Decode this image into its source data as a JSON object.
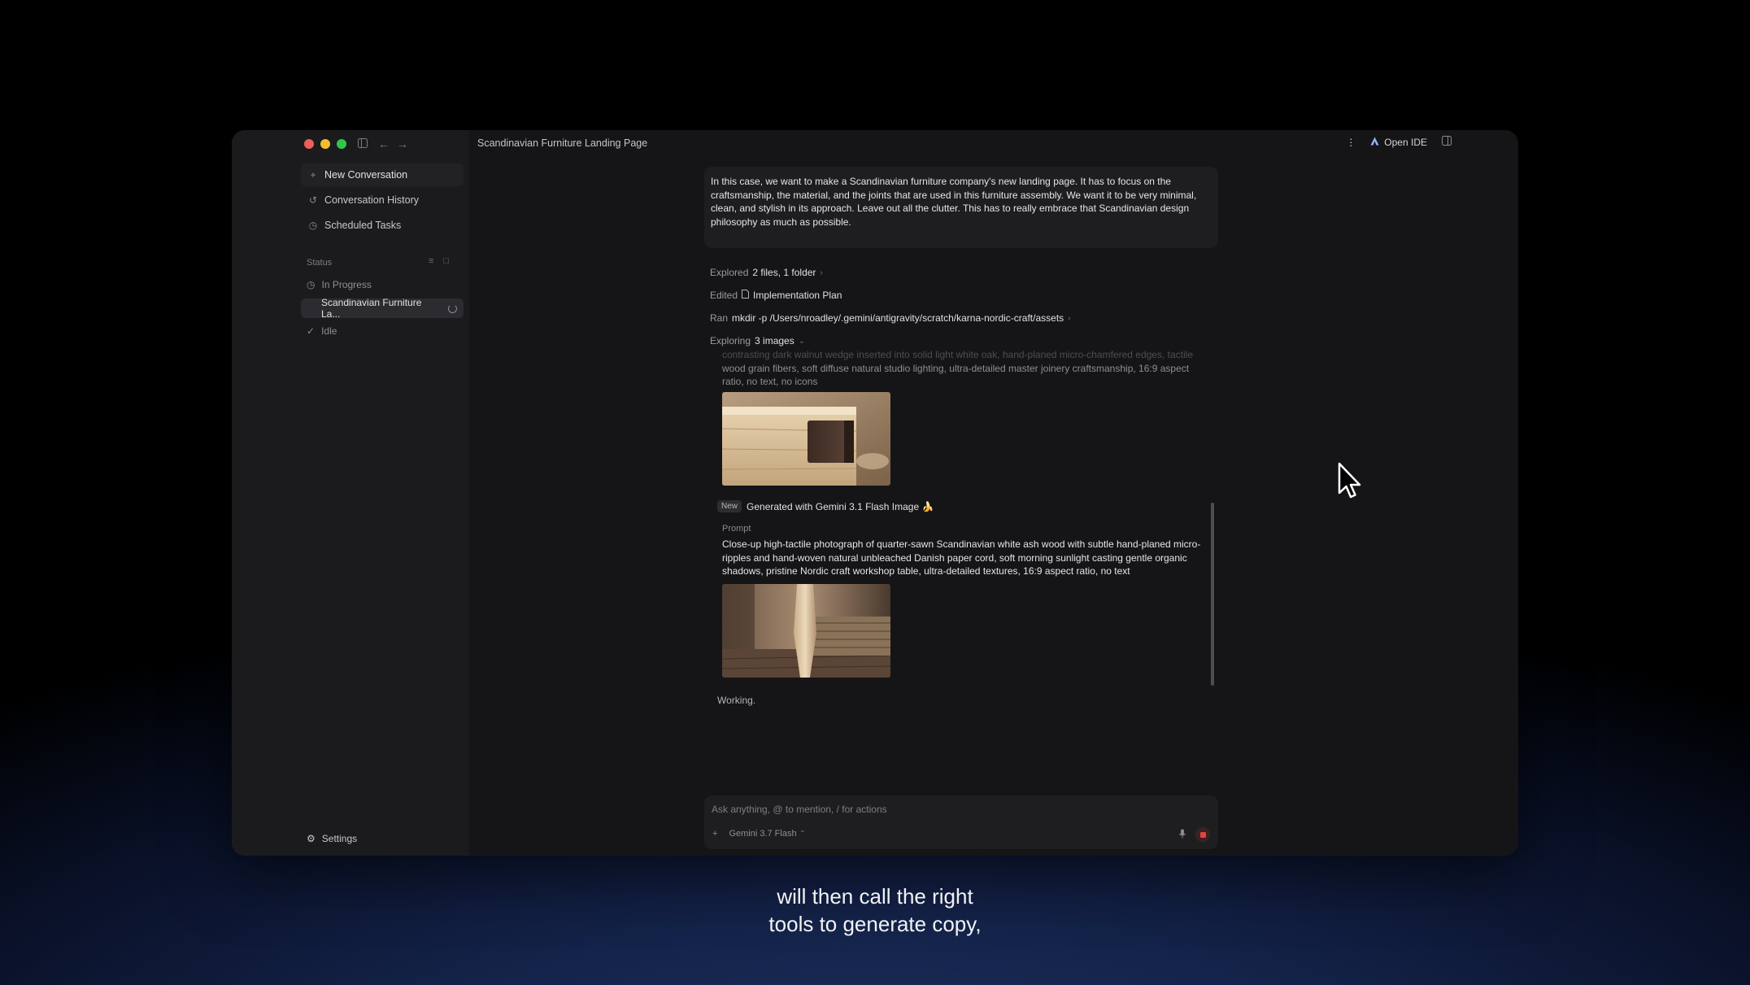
{
  "window": {
    "title": "Scandinavian Furniture Landing Page",
    "colors": {
      "accent_red": "#ee5f56",
      "accent_yellow": "#f6bd2f",
      "accent_green": "#2fc64a",
      "stop_red": "#e2453f"
    },
    "icons": [
      "sidebar-toggle-icon",
      "back-arrow-icon",
      "forward-arrow-icon"
    ]
  },
  "sidebar": {
    "new_conversation": "New Conversation",
    "conversation_history": "Conversation History",
    "scheduled_tasks": "Scheduled Tasks",
    "status_label": "Status",
    "in_progress": "In Progress",
    "active_item": "Scandinavian Furniture La...",
    "idle": "Idle",
    "settings": "Settings"
  },
  "header": {
    "more": "⋮",
    "open_ide": "Open IDE"
  },
  "conversation": {
    "user_prompt": "In this case, we want to make a Scandinavian furniture company's new landing page. It has to focus on the craftsmanship, the material, and the joints that are used in this furniture assembly. We want it to be very minimal, clean, and stylish in its approach. Leave out all the clutter. This has to really embrace that Scandinavian design philosophy as much as possible.",
    "steps": [
      {
        "verb": "Explored",
        "detail": "2 files, 1 folder"
      },
      {
        "verb": "Edited",
        "detail": "Implementation Plan"
      },
      {
        "verb": "Ran",
        "detail": "mkdir -p /Users/nroadley/.gemini/antigravity/scratch/karna-nordic-craft/assets"
      },
      {
        "verb": "Exploring",
        "detail": "3 images"
      }
    ],
    "faded_prompt_ghost": "contrasting dark walnut wedge inserted into solid light white oak, hand-planed micro-chamfered edges, tactile",
    "faded_prompt_visible_1": "wood grain fibers, soft diffuse natural studio lighting, ultra-detailed master joinery craftsmanship, 16:9 aspect",
    "faded_prompt_visible_2": "ratio, no text, no icons",
    "new_badge": "New",
    "generated_label": "Generated with Gemini 3.1 Flash Image 🍌",
    "prompt_label": "Prompt",
    "prompt_text": "Close-up high-tactile photograph of quarter-sawn Scandinavian white ash wood with subtle hand-planed micro-ripples and hand-woven natural unbleached Danish paper cord, soft morning sunlight casting gentle organic shadows, pristine Nordic craft workshop table, ultra-detailed textures, 16:9 aspect ratio, no text",
    "working": "Working."
  },
  "input": {
    "placeholder": "Ask anything, @ to mention, / for actions",
    "add": "+",
    "model": "Gemini 3.7 Flash"
  },
  "caption": {
    "line1": "will then call the right",
    "line2": "tools to generate copy,"
  }
}
